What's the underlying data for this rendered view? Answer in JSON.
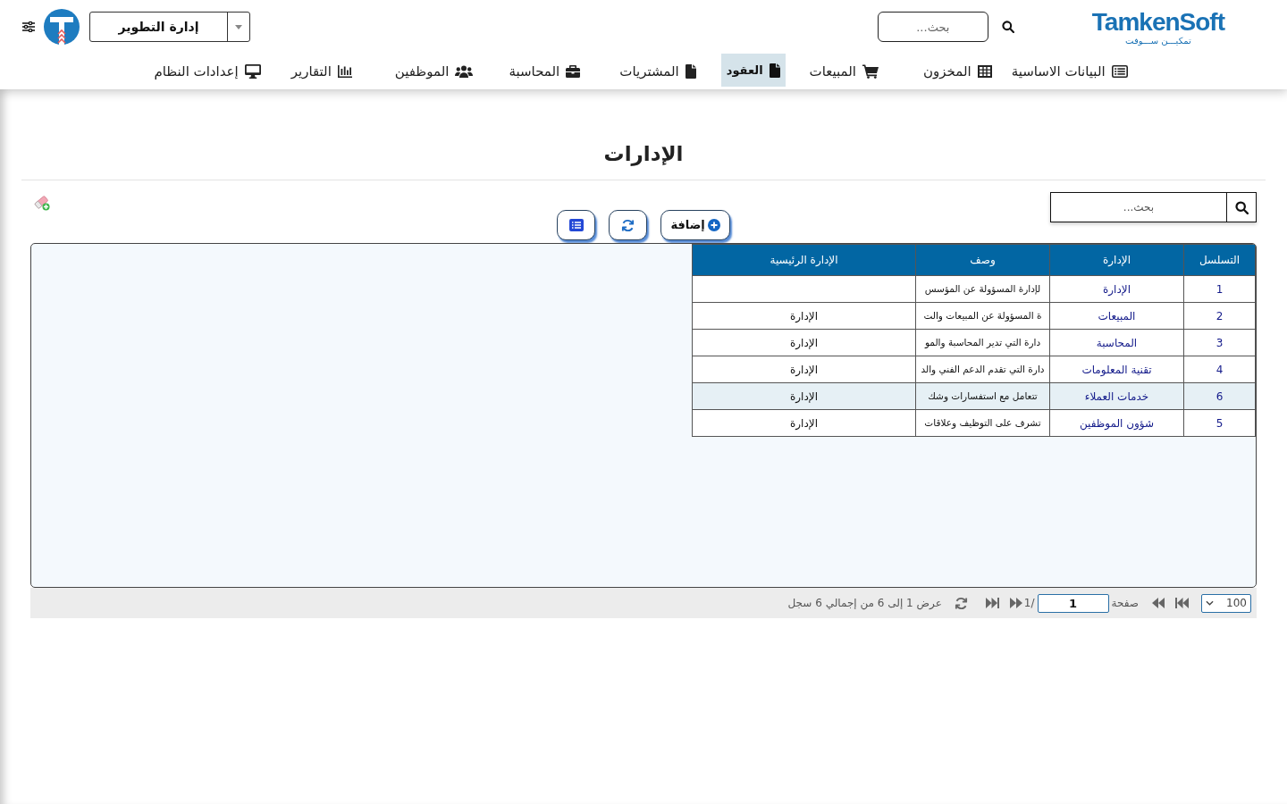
{
  "header": {
    "brand": {
      "name": "TamkenSoft",
      "tagline": "تمكيـــن ســـوفت"
    },
    "search": {
      "placeholder": "بحث..."
    },
    "department_select": {
      "value": "إدارة التطوير"
    }
  },
  "nav": [
    {
      "label": "البيانات الاساسية",
      "selected": false
    },
    {
      "label": "المخزون",
      "selected": false
    },
    {
      "label": "المبيعات",
      "selected": false
    },
    {
      "label": "العقود",
      "selected": true
    },
    {
      "label": "المشتريات",
      "selected": false
    },
    {
      "label": "المحاسبة",
      "selected": false
    },
    {
      "label": "الموظفين",
      "selected": false
    },
    {
      "label": "التقارير",
      "selected": false
    },
    {
      "label": "إعدادات النظام",
      "selected": false
    }
  ],
  "page": {
    "title": "الإدارات"
  },
  "toolbar": {
    "search": {
      "placeholder": "بحث..."
    },
    "add_label": "إضافة"
  },
  "table": {
    "columns": [
      "التسلسل",
      "الإدارة",
      "وصف",
      "الإدارة الرئيسية"
    ],
    "rows": [
      {
        "serial": "1",
        "name": "الإدارة",
        "description": "لإدارة المسؤولة عن المؤسس",
        "selected": false
      },
      {
        "serial": "2",
        "name": "المبيعات",
        "description": "ة المسؤولة عن المبيعات والت",
        "parent": "الإدارة",
        "selected": false
      },
      {
        "serial": "3",
        "name": "المحاسبة",
        "description": "دارة التي تدير المحاسبة والمو",
        "parent": "الإدارة",
        "selected": false
      },
      {
        "serial": "4",
        "name": "تقنية المعلومات",
        "description": "دارة التي تقدم الدعم الفني والد",
        "parent": "الإدارة",
        "selected": false
      },
      {
        "serial": "6",
        "name": "خدمات العملاء",
        "description": "تتعامل مع استفسارات وشك",
        "parent": "الإدارة",
        "selected": true
      },
      {
        "serial": "5",
        "name": "شؤون الموظفين",
        "description": "تشرف على التوظيف وعلاقات",
        "parent": "الإدارة",
        "selected": false
      }
    ]
  },
  "pager": {
    "page_size": "100",
    "page_label": "صفحة",
    "page": "1",
    "page_count": "/1",
    "summary": "عرض 1 إلى 6 من إجمالي 6 سجل"
  }
}
